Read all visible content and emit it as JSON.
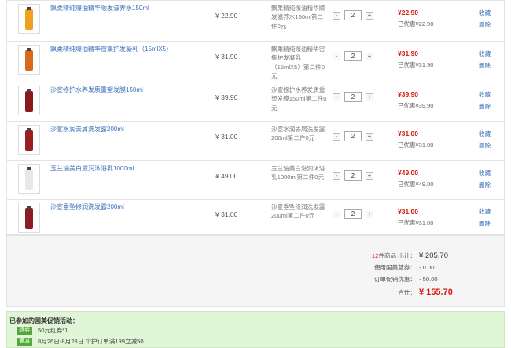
{
  "items": [
    {
      "name": "飘柔精纯爆油精华顺发滋养水150ml",
      "price": "¥ 22.90",
      "promo": "飘柔精纯爆油精华顺发滋养水150ml第二件0元",
      "qty": "2",
      "subtotal": "¥22.90",
      "saved": "已优惠¥22.90",
      "fav": "收藏",
      "del": "删除",
      "thumb_color": "#f2a020"
    },
    {
      "name": "飘柔精纯爆油精华密集护发凝乳（15mlX5）",
      "price": "¥ 31.90",
      "promo": "飘柔精纯爆油精华密集护发凝乳（15mlX5）第二件0元",
      "qty": "2",
      "subtotal": "¥31.90",
      "saved": "已优惠¥31.90",
      "fav": "收藏",
      "del": "删除",
      "thumb_color": "#d86a1a"
    },
    {
      "name": "沙宣修护水养发质重塑发膜150ml",
      "price": "¥ 39.90",
      "promo": "沙宣修护水养发质重塑发膜150ml第二件0元",
      "qty": "2",
      "subtotal": "¥39.90",
      "saved": "已优惠¥39.90",
      "fav": "收藏",
      "del": "删除",
      "thumb_color": "#8a1a1a"
    },
    {
      "name": "沙宣水润去屑洗发露200ml",
      "price": "¥ 31.00",
      "promo": "沙宣水润去屑洗发露200ml第二件0元",
      "qty": "2",
      "subtotal": "¥31.00",
      "saved": "已优惠¥31.00",
      "fav": "收藏",
      "del": "删除",
      "thumb_color": "#9a1f1f"
    },
    {
      "name": "玉兰油美白滋润沐浴乳1000ml",
      "price": "¥ 49.00",
      "promo": "玉兰油美白滋润沐浴乳1000ml第二件0元",
      "qty": "2",
      "subtotal": "¥49.00",
      "saved": "已优惠¥49.00",
      "fav": "收藏",
      "del": "删除",
      "thumb_color": "#e8e8e8"
    },
    {
      "name": "沙宣垂坠修润洗发露200ml",
      "price": "¥ 31.00",
      "promo": "沙宣垂坠修润洗发露200ml第二件0元",
      "qty": "2",
      "subtotal": "¥31.00",
      "saved": "已优惠¥31.00",
      "fav": "收藏",
      "del": "删除",
      "thumb_color": "#8e1c24"
    }
  ],
  "summary": {
    "count": "12",
    "count_label": "件商品 小计：",
    "subtotal": "¥ 205.70",
    "coupon_label": "使用国美蓝券：",
    "coupon": "- 0.00",
    "promo_label": "订单促销优惠：",
    "promo": "- 50.00",
    "total_label": "合计：",
    "total": "¥ 155.70"
  },
  "activity": {
    "title": "已参加的国美促销活动：",
    "rows": [
      {
        "tag": "返券",
        "text": "50元红券*1"
      },
      {
        "tag": "满减",
        "text": "8月26日-8月28日 个护订单满199立减50"
      }
    ]
  },
  "colors": {
    "price_red": "#d8190d",
    "link_blue": "#3a6fb8",
    "tag_green": "#52a83b",
    "activity_bg": "#e1f5d7"
  }
}
